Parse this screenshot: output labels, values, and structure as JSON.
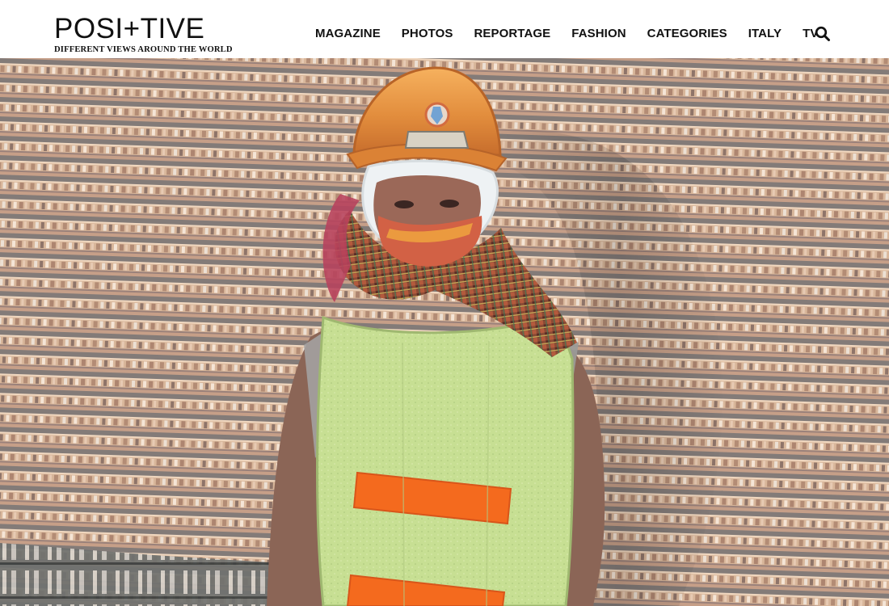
{
  "site": {
    "brand_name": "POSI+TIVE",
    "tagline": "DIFFERENT VIEWS AROUND THE WORLD"
  },
  "nav": {
    "items": [
      {
        "label": "MAGAZINE"
      },
      {
        "label": "PHOTOS"
      },
      {
        "label": "REPORTAGE"
      },
      {
        "label": "FASHION"
      },
      {
        "label": "CATEGORIES"
      },
      {
        "label": "ITALY"
      },
      {
        "label": "TV"
      }
    ],
    "search_icon": "search-icon"
  },
  "hero": {
    "image_subject": "worker-portrait",
    "colors": {
      "helmet": "#e69b45",
      "vest": "#c6df91",
      "reflective_stripe": "#f46a1e",
      "shirt": "#8c6657"
    }
  }
}
